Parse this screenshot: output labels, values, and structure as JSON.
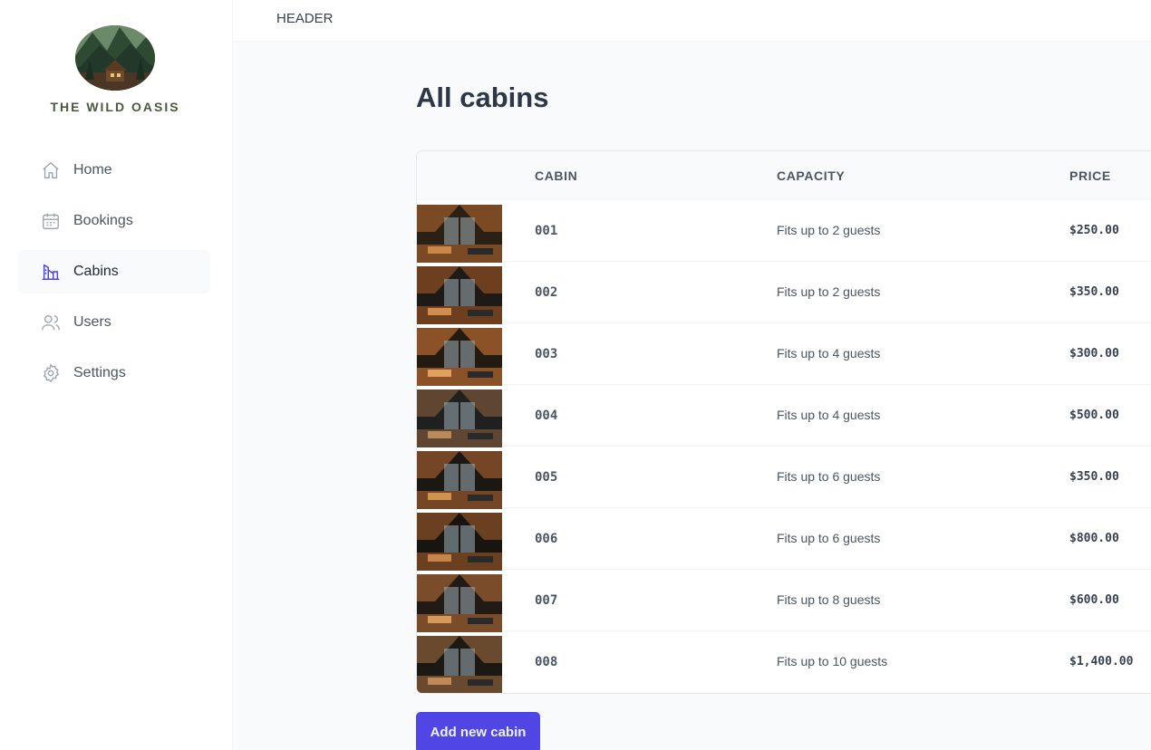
{
  "brand": {
    "name": "THE WILD OASIS",
    "logo_icon": "mountain-cabin-logo"
  },
  "header": {
    "label": "HEADER"
  },
  "sidebar": {
    "items": [
      {
        "label": "Home",
        "icon": "home-icon",
        "active": false
      },
      {
        "label": "Bookings",
        "icon": "calendar-icon",
        "active": false
      },
      {
        "label": "Cabins",
        "icon": "cabins-icon",
        "active": true
      },
      {
        "label": "Users",
        "icon": "users-icon",
        "active": false
      },
      {
        "label": "Settings",
        "icon": "gear-icon",
        "active": false
      }
    ]
  },
  "main": {
    "title": "All cabins",
    "table": {
      "columns": [
        "",
        "CABIN",
        "CAPACITY",
        "PRICE"
      ],
      "rows": [
        {
          "name": "001",
          "capacity": "Fits up to 2 guests",
          "price": "$250.00"
        },
        {
          "name": "002",
          "capacity": "Fits up to 2 guests",
          "price": "$350.00"
        },
        {
          "name": "003",
          "capacity": "Fits up to 4 guests",
          "price": "$300.00"
        },
        {
          "name": "004",
          "capacity": "Fits up to 4 guests",
          "price": "$500.00"
        },
        {
          "name": "005",
          "capacity": "Fits up to 6 guests",
          "price": "$350.00"
        },
        {
          "name": "006",
          "capacity": "Fits up to 6 guests",
          "price": "$800.00"
        },
        {
          "name": "007",
          "capacity": "Fits up to 8 guests",
          "price": "$600.00"
        },
        {
          "name": "008",
          "capacity": "Fits up to 10 guests",
          "price": "$1,400.00"
        }
      ]
    },
    "add_button": "Add new cabin"
  },
  "colors": {
    "accent": "#4f46e5",
    "accent_text": "#eef2ff",
    "brand_text": "#4b5a3c",
    "background": "#f9fafb"
  }
}
